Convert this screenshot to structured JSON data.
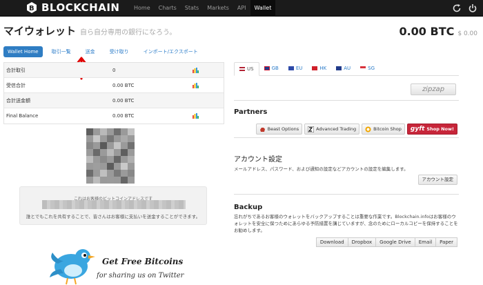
{
  "brand": {
    "name": "BLOCKCHAIN"
  },
  "nav": {
    "items": [
      "Home",
      "Charts",
      "Stats",
      "Markets",
      "API",
      "Wallet"
    ],
    "active": "Wallet"
  },
  "header": {
    "title": "マイウォレット",
    "subtitle": "自ら自分専用の銀行になろう。",
    "balance_btc": "0.00 BTC",
    "balance_usd": "$ 0.00"
  },
  "tabs": [
    "Wallet Home",
    "取引一覧",
    "送金",
    "受け取り",
    "インポート/エクスポート"
  ],
  "stats": [
    {
      "label": "合計取引",
      "value": "0"
    },
    {
      "label": "受信合計",
      "value": "0.00 BTC"
    },
    {
      "label": "合計送金額",
      "value": "0.00 BTC"
    },
    {
      "label": "Final Balance",
      "value": "0.00 BTC"
    }
  ],
  "address": {
    "label": "これはお客様のビットコインアドレスです",
    "note": "誰とでもこれを共有することで、皆さんはお客様に支払いを送金することができます。"
  },
  "promo": {
    "line1": "Get Free Bitcoins",
    "line2": "for sharing us on Twitter"
  },
  "currencies": [
    {
      "code": "US",
      "color": "#c0392b"
    },
    {
      "code": "GB",
      "color": "#1f3f8c"
    },
    {
      "code": "EU",
      "color": "#2e4aa8"
    },
    {
      "code": "HK",
      "color": "#d0202a"
    },
    {
      "code": "AU",
      "color": "#213b8a"
    },
    {
      "code": "SG",
      "color": "#d8323c"
    }
  ],
  "zipzap": "zipzap",
  "partners": {
    "title": "Partners",
    "buttons": [
      "Beast Options",
      "Advanced Trading",
      "Bitcoin Shop",
      "Shop Now!"
    ],
    "gyft": "gyft"
  },
  "account": {
    "title": "アカウント設定",
    "desc": "メールアドレス、パスワード、および通知の設定などアカウントの設定を編集します。",
    "button": "アカウント設定"
  },
  "backup": {
    "title": "Backup",
    "desc": "忘れがちであるお客様のウォレットをバックアップすることは重要な作業です。Blockchain.infoはお客様のウォレットを安全に保つためにあらゆる予防措置を講じていますが、念のためにローカルコピーを保持することをお勧めします。",
    "buttons": [
      "Download",
      "Dropbox",
      "Google Drive",
      "Email",
      "Paper"
    ]
  }
}
